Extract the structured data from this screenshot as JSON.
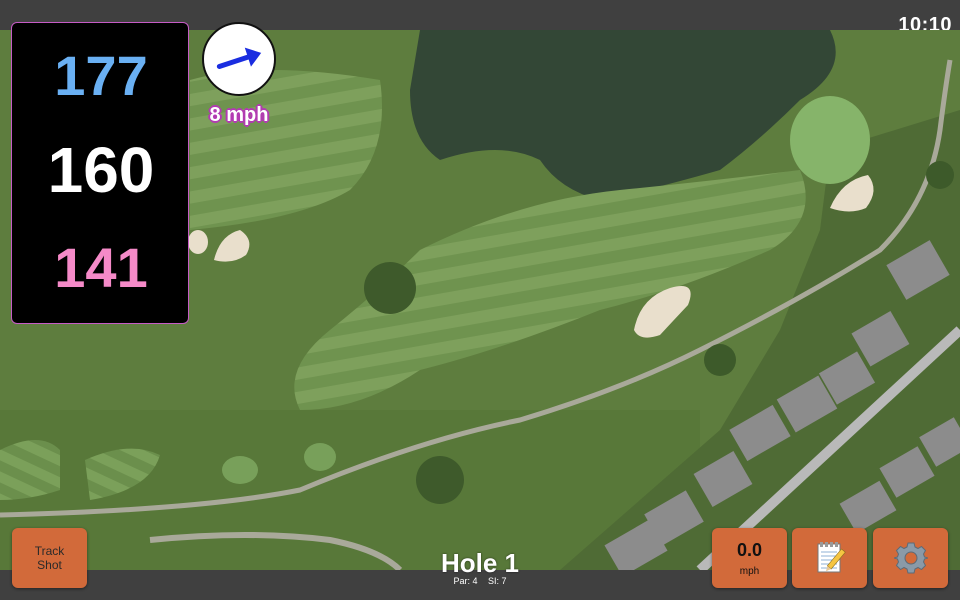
{
  "status": {
    "clock": "10:10"
  },
  "yardage": {
    "back": "177",
    "center": "160",
    "front": "141",
    "colors": {
      "back": "#6ab0f3",
      "center": "#ffffff",
      "front": "#f58ac8"
    }
  },
  "wind": {
    "speed_label": "8 mph",
    "arrow_icon": "wind-direction-arrow-icon"
  },
  "buttons": {
    "track_shot_line1": "Track",
    "track_shot_line2": "Shot",
    "speed_value": "0.0",
    "speed_unit": "mph",
    "notes_icon": "notepad-icon",
    "settings_icon": "gear-icon"
  },
  "hole": {
    "title": "Hole 1",
    "par": "Par: 4",
    "stroke_index": "SI: 7"
  },
  "colors": {
    "button": "#d26a3a",
    "panel_border": "#c65bc6",
    "bar": "#404040"
  }
}
